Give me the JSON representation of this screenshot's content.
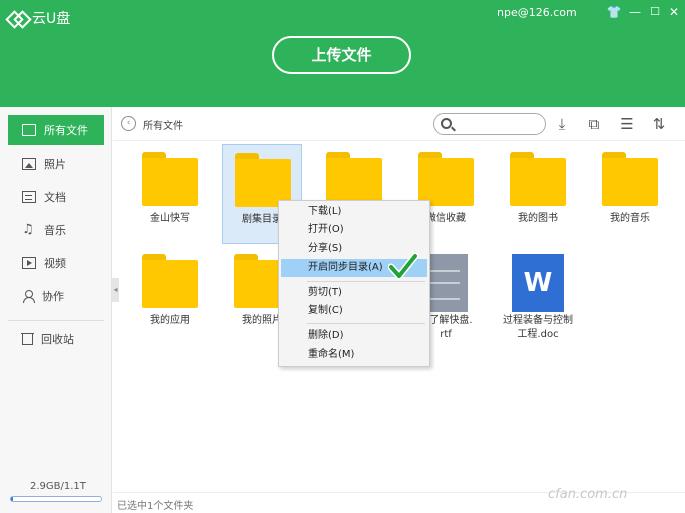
{
  "app": {
    "title": "云U盘",
    "user_email": "npe@126.com"
  },
  "window_controls": [
    "shirt-icon",
    "minimize-icon",
    "maximize-icon",
    "close-icon"
  ],
  "header": {
    "upload_label": "上传文件"
  },
  "sidebar": {
    "items": [
      {
        "label": "所有文件",
        "icon": "folder-icon",
        "active": true
      },
      {
        "label": "照片",
        "icon": "photo-icon"
      },
      {
        "label": "文档",
        "icon": "document-icon"
      },
      {
        "label": "音乐",
        "icon": "music-icon"
      },
      {
        "label": "视频",
        "icon": "video-icon"
      },
      {
        "label": "协作",
        "icon": "user-icon"
      }
    ],
    "recycle": {
      "label": "回收站",
      "icon": "trash-icon"
    },
    "storage": {
      "text": "2.9GB/1.1T",
      "used_fraction": 0.0026
    }
  },
  "toolbar": {
    "breadcrumb": "所有文件",
    "search_placeholder": "",
    "tools": [
      "download-icon",
      "new-folder-icon",
      "list-view-icon",
      "sort-icon"
    ]
  },
  "files": [
    {
      "name": "金山快写",
      "type": "folder"
    },
    {
      "name": "剧集目录",
      "type": "folder",
      "selected": true
    },
    {
      "name": "",
      "type": "folder"
    },
    {
      "name": "微信收藏",
      "type": "folder"
    },
    {
      "name": "我的图书",
      "type": "folder"
    },
    {
      "name": "我的音乐",
      "type": "folder"
    },
    {
      "name": "我的应用",
      "type": "folder"
    },
    {
      "name": "我的照片",
      "type": "folder"
    },
    {
      "name": "里了解快盘.\nrtf",
      "type": "rtf"
    },
    {
      "name": "过程装备与控制\n工程.doc",
      "type": "doc"
    }
  ],
  "context_menu": {
    "items": [
      {
        "label": "下载(L)"
      },
      {
        "label": "打开(O)"
      },
      {
        "label": "分享(S)"
      },
      {
        "label": "开启同步目录(A)",
        "highlighted": true
      },
      {
        "label": "剪切(T)"
      },
      {
        "label": "复制(C)"
      },
      {
        "label": "删除(D)"
      },
      {
        "label": "重命名(M)"
      }
    ]
  },
  "status": {
    "text": "已选中1个文件夹"
  },
  "watermark": "cfan.com.cn",
  "colors": {
    "brand_green": "#2fb35a",
    "folder_yellow": "#ffc800",
    "highlight_blue": "#9fd0f6",
    "word_blue": "#2f6fd4"
  }
}
